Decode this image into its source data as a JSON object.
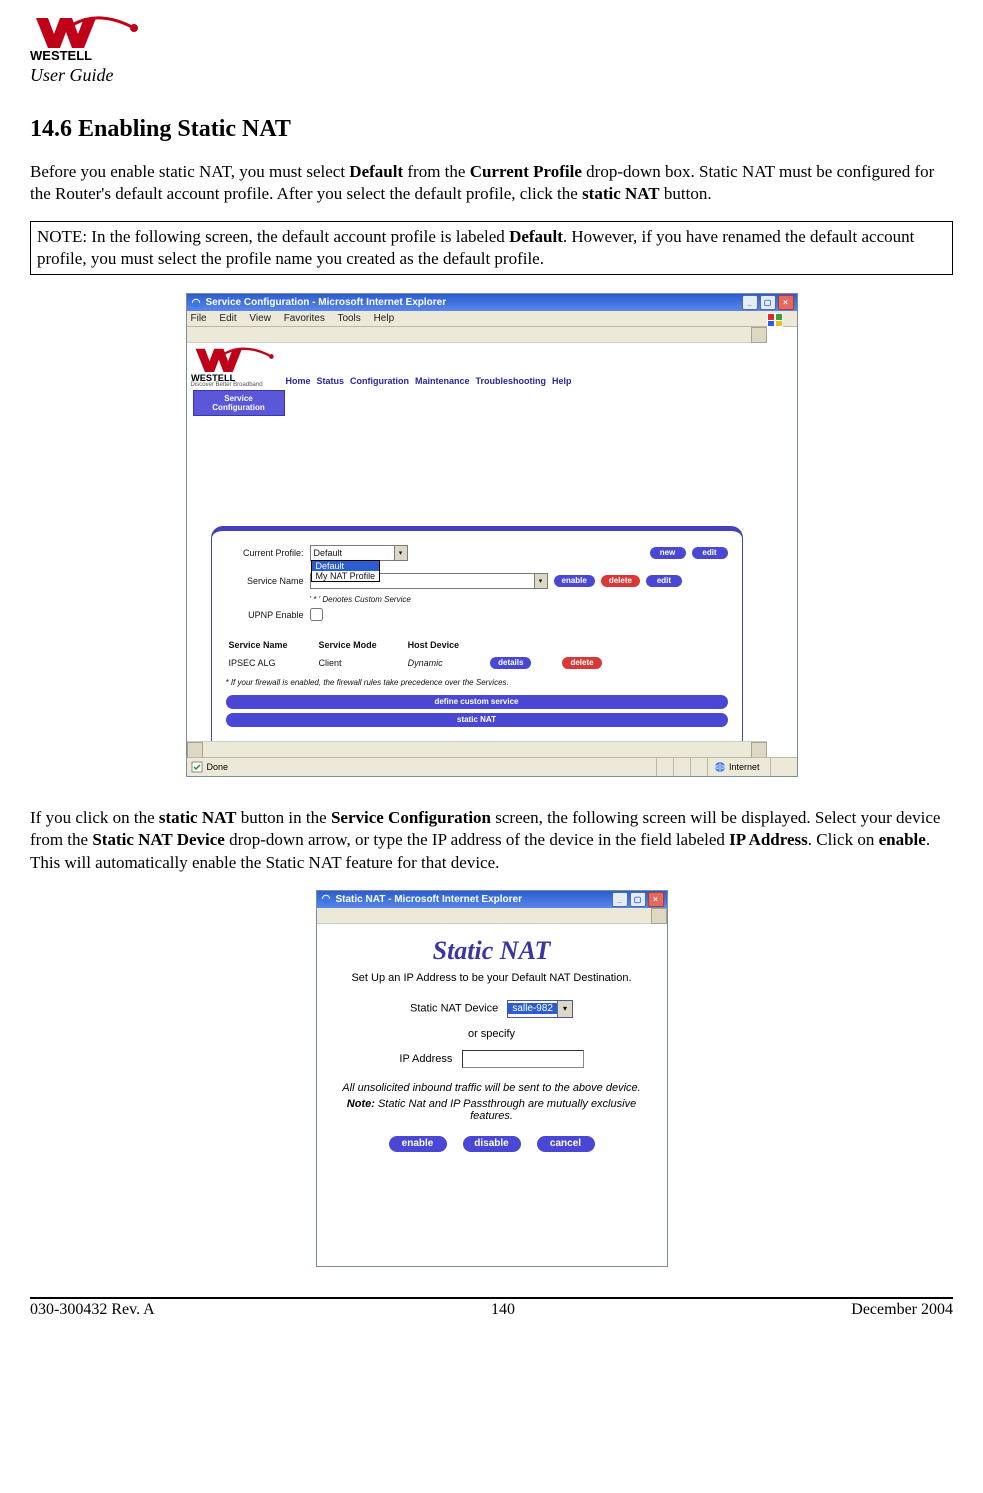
{
  "header": {
    "user_guide": "User Guide"
  },
  "section": {
    "title": "14.6 Enabling Static NAT"
  },
  "para1": {
    "t1": "Before you enable static NAT, you must select ",
    "b1": "Default",
    "t2": " from the ",
    "b2": "Current Profile",
    "t3": " drop-down box. Static NAT must be configured for the Router's default account profile. After you select the default profile, click the ",
    "b3": "static NAT",
    "t4": " button."
  },
  "note": {
    "t1": "NOTE: In the following screen, the default account profile is labeled ",
    "b1": "Default",
    "t2": ". However, if you have renamed the default account profile, you must select the profile name you created as the default profile."
  },
  "para2": {
    "t1": "If you click on the ",
    "b1": "static NAT",
    "t2": " button in the ",
    "b2": "Service Configuration",
    "t3": " screen, the following screen will be displayed. Select your device from the ",
    "b3": "Static NAT Device",
    "t4": " drop-down arrow, or type the IP address of the device in the field labeled ",
    "b4": "IP Address",
    "t5": ". Click on ",
    "b5": "enable",
    "t6": ". This will automatically enable the Static NAT feature for that device."
  },
  "screenshot1": {
    "title": "Service Configuration - Microsoft Internet Explorer",
    "menubar": [
      "File",
      "Edit",
      "View",
      "Favorites",
      "Tools",
      "Help"
    ],
    "tagline": "Discover Better Broadband",
    "nav": [
      "Home",
      "Status",
      "Configuration",
      "Maintenance",
      "Troubleshooting",
      "Help"
    ],
    "active_tab_l1": "Service",
    "active_tab_l2": "Configuration",
    "current_profile_label": "Current Profile:",
    "current_profile_value": "Default",
    "profile_options": [
      "Default",
      "My NAT Profile"
    ],
    "service_name_label": "Service Name",
    "custom_note": "' * ' Denotes Custom Service",
    "upnp_label": "UPNP Enable",
    "btn_new": "new",
    "btn_edit": "edit",
    "btn_enable": "enable",
    "btn_delete": "delete",
    "th_service_name": "Service Name",
    "th_service_mode": "Service Mode",
    "th_host_device": "Host Device",
    "row_service": "IPSEC ALG",
    "row_mode": "Client",
    "row_host": "Dynamic",
    "btn_details": "details",
    "firewall_note": "* If your firewall is enabled, the firewall rules take precedence over the Services.",
    "btn_define_custom": "define custom service",
    "btn_static_nat": "static NAT",
    "status_done": "Done",
    "status_internet": "Internet"
  },
  "screenshot2": {
    "title": "Static NAT - Microsoft Internet Explorer",
    "h1": "Static NAT",
    "line1": "Set Up an IP Address to be your Default NAT Destination.",
    "dev_label": "Static NAT Device",
    "dev_value": "salle-982",
    "or": "or specify",
    "ip_label": "IP Address",
    "note_l1": "All unsolicited inbound traffic will be sent to the above device.",
    "note_l2_b": "Note:",
    "note_l2": " Static Nat and IP Passthrough are mutually exclusive features.",
    "btn_enable": "enable",
    "btn_disable": "disable",
    "btn_cancel": "cancel"
  },
  "footer": {
    "left": "030-300432 Rev. A",
    "center": "140",
    "right": "December 2004"
  }
}
